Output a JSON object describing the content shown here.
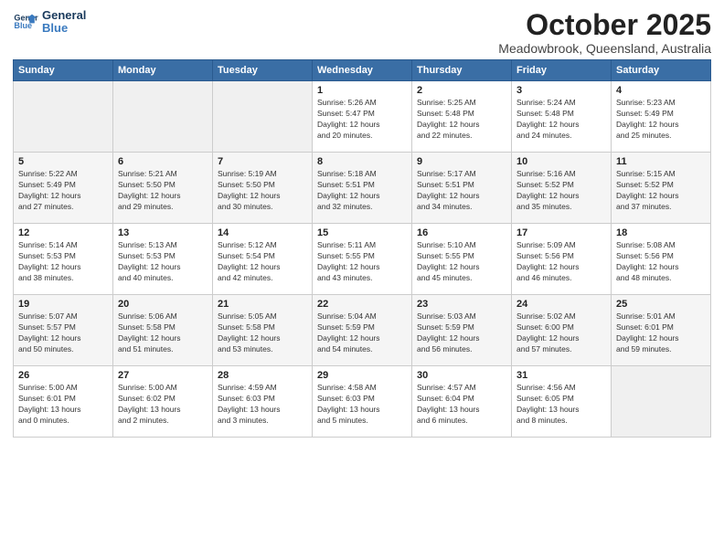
{
  "logo": {
    "line1": "General",
    "line2": "Blue"
  },
  "title": "October 2025",
  "subtitle": "Meadowbrook, Queensland, Australia",
  "days_of_week": [
    "Sunday",
    "Monday",
    "Tuesday",
    "Wednesday",
    "Thursday",
    "Friday",
    "Saturday"
  ],
  "weeks": [
    [
      {
        "day": "",
        "info": ""
      },
      {
        "day": "",
        "info": ""
      },
      {
        "day": "",
        "info": ""
      },
      {
        "day": "1",
        "info": "Sunrise: 5:26 AM\nSunset: 5:47 PM\nDaylight: 12 hours\nand 20 minutes."
      },
      {
        "day": "2",
        "info": "Sunrise: 5:25 AM\nSunset: 5:48 PM\nDaylight: 12 hours\nand 22 minutes."
      },
      {
        "day": "3",
        "info": "Sunrise: 5:24 AM\nSunset: 5:48 PM\nDaylight: 12 hours\nand 24 minutes."
      },
      {
        "day": "4",
        "info": "Sunrise: 5:23 AM\nSunset: 5:49 PM\nDaylight: 12 hours\nand 25 minutes."
      }
    ],
    [
      {
        "day": "5",
        "info": "Sunrise: 5:22 AM\nSunset: 5:49 PM\nDaylight: 12 hours\nand 27 minutes."
      },
      {
        "day": "6",
        "info": "Sunrise: 5:21 AM\nSunset: 5:50 PM\nDaylight: 12 hours\nand 29 minutes."
      },
      {
        "day": "7",
        "info": "Sunrise: 5:19 AM\nSunset: 5:50 PM\nDaylight: 12 hours\nand 30 minutes."
      },
      {
        "day": "8",
        "info": "Sunrise: 5:18 AM\nSunset: 5:51 PM\nDaylight: 12 hours\nand 32 minutes."
      },
      {
        "day": "9",
        "info": "Sunrise: 5:17 AM\nSunset: 5:51 PM\nDaylight: 12 hours\nand 34 minutes."
      },
      {
        "day": "10",
        "info": "Sunrise: 5:16 AM\nSunset: 5:52 PM\nDaylight: 12 hours\nand 35 minutes."
      },
      {
        "day": "11",
        "info": "Sunrise: 5:15 AM\nSunset: 5:52 PM\nDaylight: 12 hours\nand 37 minutes."
      }
    ],
    [
      {
        "day": "12",
        "info": "Sunrise: 5:14 AM\nSunset: 5:53 PM\nDaylight: 12 hours\nand 38 minutes."
      },
      {
        "day": "13",
        "info": "Sunrise: 5:13 AM\nSunset: 5:53 PM\nDaylight: 12 hours\nand 40 minutes."
      },
      {
        "day": "14",
        "info": "Sunrise: 5:12 AM\nSunset: 5:54 PM\nDaylight: 12 hours\nand 42 minutes."
      },
      {
        "day": "15",
        "info": "Sunrise: 5:11 AM\nSunset: 5:55 PM\nDaylight: 12 hours\nand 43 minutes."
      },
      {
        "day": "16",
        "info": "Sunrise: 5:10 AM\nSunset: 5:55 PM\nDaylight: 12 hours\nand 45 minutes."
      },
      {
        "day": "17",
        "info": "Sunrise: 5:09 AM\nSunset: 5:56 PM\nDaylight: 12 hours\nand 46 minutes."
      },
      {
        "day": "18",
        "info": "Sunrise: 5:08 AM\nSunset: 5:56 PM\nDaylight: 12 hours\nand 48 minutes."
      }
    ],
    [
      {
        "day": "19",
        "info": "Sunrise: 5:07 AM\nSunset: 5:57 PM\nDaylight: 12 hours\nand 50 minutes."
      },
      {
        "day": "20",
        "info": "Sunrise: 5:06 AM\nSunset: 5:58 PM\nDaylight: 12 hours\nand 51 minutes."
      },
      {
        "day": "21",
        "info": "Sunrise: 5:05 AM\nSunset: 5:58 PM\nDaylight: 12 hours\nand 53 minutes."
      },
      {
        "day": "22",
        "info": "Sunrise: 5:04 AM\nSunset: 5:59 PM\nDaylight: 12 hours\nand 54 minutes."
      },
      {
        "day": "23",
        "info": "Sunrise: 5:03 AM\nSunset: 5:59 PM\nDaylight: 12 hours\nand 56 minutes."
      },
      {
        "day": "24",
        "info": "Sunrise: 5:02 AM\nSunset: 6:00 PM\nDaylight: 12 hours\nand 57 minutes."
      },
      {
        "day": "25",
        "info": "Sunrise: 5:01 AM\nSunset: 6:01 PM\nDaylight: 12 hours\nand 59 minutes."
      }
    ],
    [
      {
        "day": "26",
        "info": "Sunrise: 5:00 AM\nSunset: 6:01 PM\nDaylight: 13 hours\nand 0 minutes."
      },
      {
        "day": "27",
        "info": "Sunrise: 5:00 AM\nSunset: 6:02 PM\nDaylight: 13 hours\nand 2 minutes."
      },
      {
        "day": "28",
        "info": "Sunrise: 4:59 AM\nSunset: 6:03 PM\nDaylight: 13 hours\nand 3 minutes."
      },
      {
        "day": "29",
        "info": "Sunrise: 4:58 AM\nSunset: 6:03 PM\nDaylight: 13 hours\nand 5 minutes."
      },
      {
        "day": "30",
        "info": "Sunrise: 4:57 AM\nSunset: 6:04 PM\nDaylight: 13 hours\nand 6 minutes."
      },
      {
        "day": "31",
        "info": "Sunrise: 4:56 AM\nSunset: 6:05 PM\nDaylight: 13 hours\nand 8 minutes."
      },
      {
        "day": "",
        "info": ""
      }
    ]
  ]
}
